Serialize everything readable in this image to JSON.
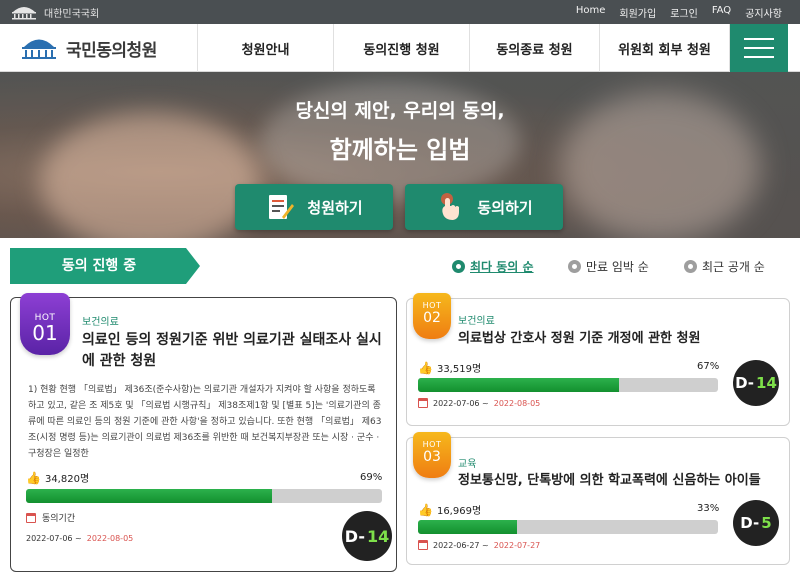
{
  "top_strip": {
    "assembly_name": "대한민국국회",
    "links": [
      "Home",
      "회원가입",
      "로그인",
      "FAQ",
      "공지사항"
    ]
  },
  "header": {
    "logo_text": "국민동의청원",
    "nav": [
      "청원안내",
      "동의진행 청원",
      "동의종료 청원",
      "위원회 회부 청원"
    ]
  },
  "hero": {
    "line1": "당신의 제안, 우리의 동의,",
    "line2": "함께하는 입법",
    "buttons": [
      "청원하기",
      "동의하기"
    ]
  },
  "section": {
    "title": "동의 진행 중",
    "sort_options": [
      "최다 동의 순",
      "만료 임박 순",
      "최근 공개 순"
    ],
    "active_sort": "최다 동의 순"
  },
  "colors": {
    "brand_green": "#1f8a6e",
    "progress_green": "#13902f",
    "hot_purple": "#6a2bb8",
    "hot_orange": "#f29a16",
    "date_end_red": "#d9534f"
  },
  "petitions": [
    {
      "hot_label": "HOT",
      "rank": "01",
      "category": "보건의료",
      "title": "의료인 등의 정원기준 위반 의료기관 실태조사 실시에 관한 청원",
      "summary": "1) 현황 현행 「의료법」 제36조(준수사항)는 의료기관 개설자가 지켜야 할 사항을 정하도록 하고 있고, 같은 조 제5호 및 「의료법 시행규칙」 제38조제1항 및 [별표 5]는 '의료기관의 종류에 따른 의료인 등의 정원 기준에 관한 사항'을 정하고 있습니다. 또한 현행 「의료법」 제63조(시정 명령 등)는 의료기관이 의료법 제36조를 위반한 때 보건복지부장관 또는 시장 · 군수 · 구청장은 일정한",
      "agree_count": "34,820명",
      "percent_text": "69%",
      "percent": 69,
      "period_label": "동의기간",
      "start_date": "2022-07-06 ~",
      "end_date": "2022-08-05",
      "dday_prefix": "D-",
      "dday_num": "14"
    },
    {
      "hot_label": "HOT",
      "rank": "02",
      "category": "보건의료",
      "title": "의료법상 간호사 정원 기준 개정에 관한 청원",
      "agree_count": "33,519명",
      "percent_text": "67%",
      "percent": 67,
      "start_date": "2022-07-06 ~",
      "end_date": "2022-08-05",
      "dday_prefix": "D-",
      "dday_num": "14"
    },
    {
      "hot_label": "HOT",
      "rank": "03",
      "category": "교육",
      "title": "정보통신망, 단톡방에 의한 학교폭력에 신음하는 아이들",
      "agree_count": "16,969명",
      "percent_text": "33%",
      "percent": 33,
      "start_date": "2022-06-27 ~",
      "end_date": "2022-07-27",
      "dday_prefix": "D-",
      "dday_num": "5"
    }
  ]
}
